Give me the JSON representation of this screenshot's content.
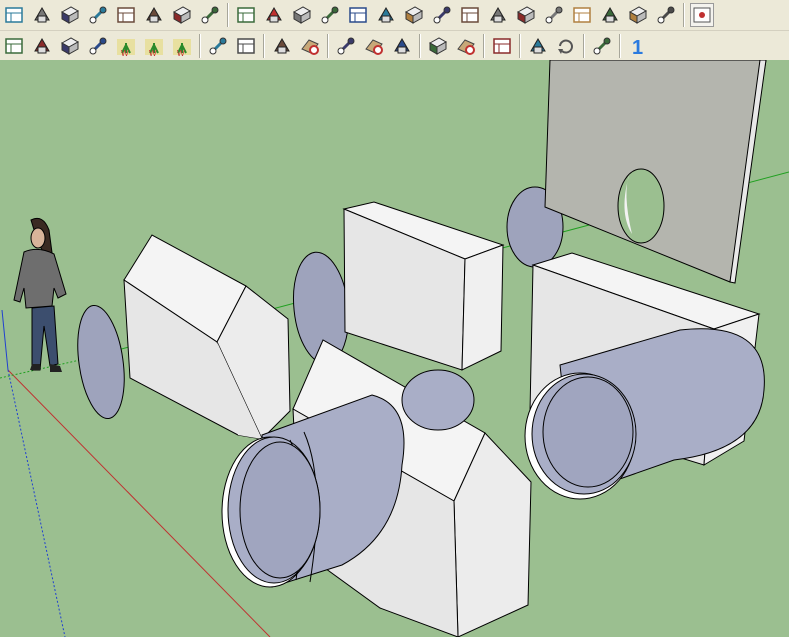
{
  "app": "SketchUp",
  "toolbar_row1": {
    "groups": [
      [
        "window-panel-icon",
        "window-frame-icon",
        "stair-rail-icon",
        "fence-panel-icon",
        "railing-icon",
        "balustrade-icon",
        "gate-icon",
        "handrail-icon"
      ],
      [
        "search-zoom-icon",
        "steel-beam-icon",
        "wood-beam-icon",
        "roof-frame-icon",
        "column-profile-icon",
        "sheet-metal-icon",
        "arch-profile-icon",
        "box-shape-icon",
        "angle-profile-icon",
        "wall-panel-icon",
        "slope-line-icon",
        "stairs-icon",
        "brick-wall-icon",
        "gable-roof-icon",
        "rafter-icon",
        "ruler-edit-icon"
      ],
      [
        "help-window-icon"
      ]
    ]
  },
  "toolbar_row2": {
    "groups": [
      [
        "terrain-icon",
        "landscape-icon",
        "hatch-fill-icon",
        "no-fill-icon",
        "plant-red-icon",
        "plant-green-icon",
        "cut-plant-icon"
      ],
      [
        "add-component-icon",
        "paint-component-icon"
      ],
      [
        "extrude-face-icon",
        "extrude-target-icon"
      ],
      [
        "shape-a-icon",
        "shape-target-icon",
        "shape-b-icon"
      ],
      [
        "line-path-icon",
        "line-target-icon"
      ],
      [
        "fold-icon"
      ],
      [
        "material-cube-icon",
        "refresh-icon"
      ],
      [
        "curved-surface-icon"
      ],
      [
        "number-one-icon"
      ]
    ]
  },
  "colors": {
    "ground": "#9bbf90",
    "toolbar": "#ece9d8",
    "face_white": "#f2f2f2",
    "face_shadow": "#e0e0e0",
    "cylinder": "#a9aec7",
    "disc": "#9ea3bc",
    "panel": "#b4b5ae"
  }
}
